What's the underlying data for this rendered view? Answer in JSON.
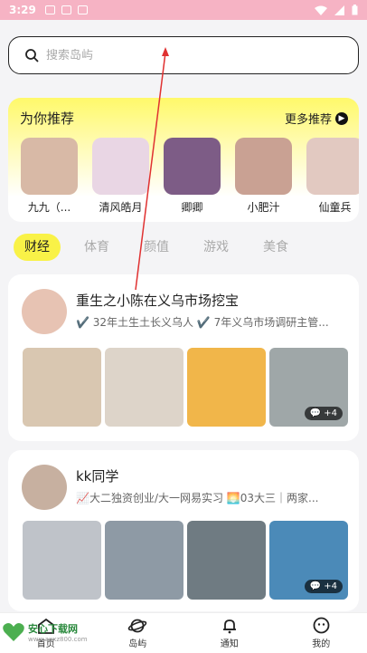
{
  "status": {
    "time": "3:29"
  },
  "search": {
    "placeholder": "搜索岛屿"
  },
  "recommend": {
    "title": "为你推荐",
    "more_label": "更多推荐",
    "items": [
      {
        "name": "九九（...",
        "color": "#d8b9a6"
      },
      {
        "name": "清风皓月",
        "color": "#e9d6e4"
      },
      {
        "name": "卿卿",
        "color": "#7d5c86"
      },
      {
        "name": "小肥汁",
        "color": "#c9a193"
      },
      {
        "name": "仙童兵",
        "color": "#e2c9c1"
      }
    ]
  },
  "tabs": [
    {
      "label": "财经",
      "active": true
    },
    {
      "label": "体育",
      "active": false
    },
    {
      "label": "颜值",
      "active": false
    },
    {
      "label": "游戏",
      "active": false
    },
    {
      "label": "美食",
      "active": false
    }
  ],
  "creators": [
    {
      "name": "重生之小陈在义乌市场挖宝",
      "desc": "✔️ 32年土生土长义乌人 ✔️ 7年义乌市场调研主管...",
      "avatar_color": "#e7c3b3",
      "thumbs": [
        "#d9c7b1",
        "#ddd4c9",
        "#f1b64a",
        "#9fa7a8"
      ],
      "more_count": "+4"
    },
    {
      "name": "kk同学",
      "desc": "📈大二独资创业/大一网易实习 🌅03大三｜两家...",
      "avatar_color": "#c7b0a0",
      "thumbs": [
        "#bfc3c9",
        "#8e9aa5",
        "#6f7b82",
        "#4b8ab8"
      ],
      "more_count": "+4"
    }
  ],
  "nav": [
    {
      "label": "首页",
      "icon": "home-icon"
    },
    {
      "label": "岛屿",
      "icon": "planet-icon"
    },
    {
      "label": "通知",
      "icon": "bell-icon"
    },
    {
      "label": "我的",
      "icon": "face-icon"
    }
  ],
  "watermark": {
    "text": "安心下载网",
    "url": "www.axxz800.com"
  }
}
